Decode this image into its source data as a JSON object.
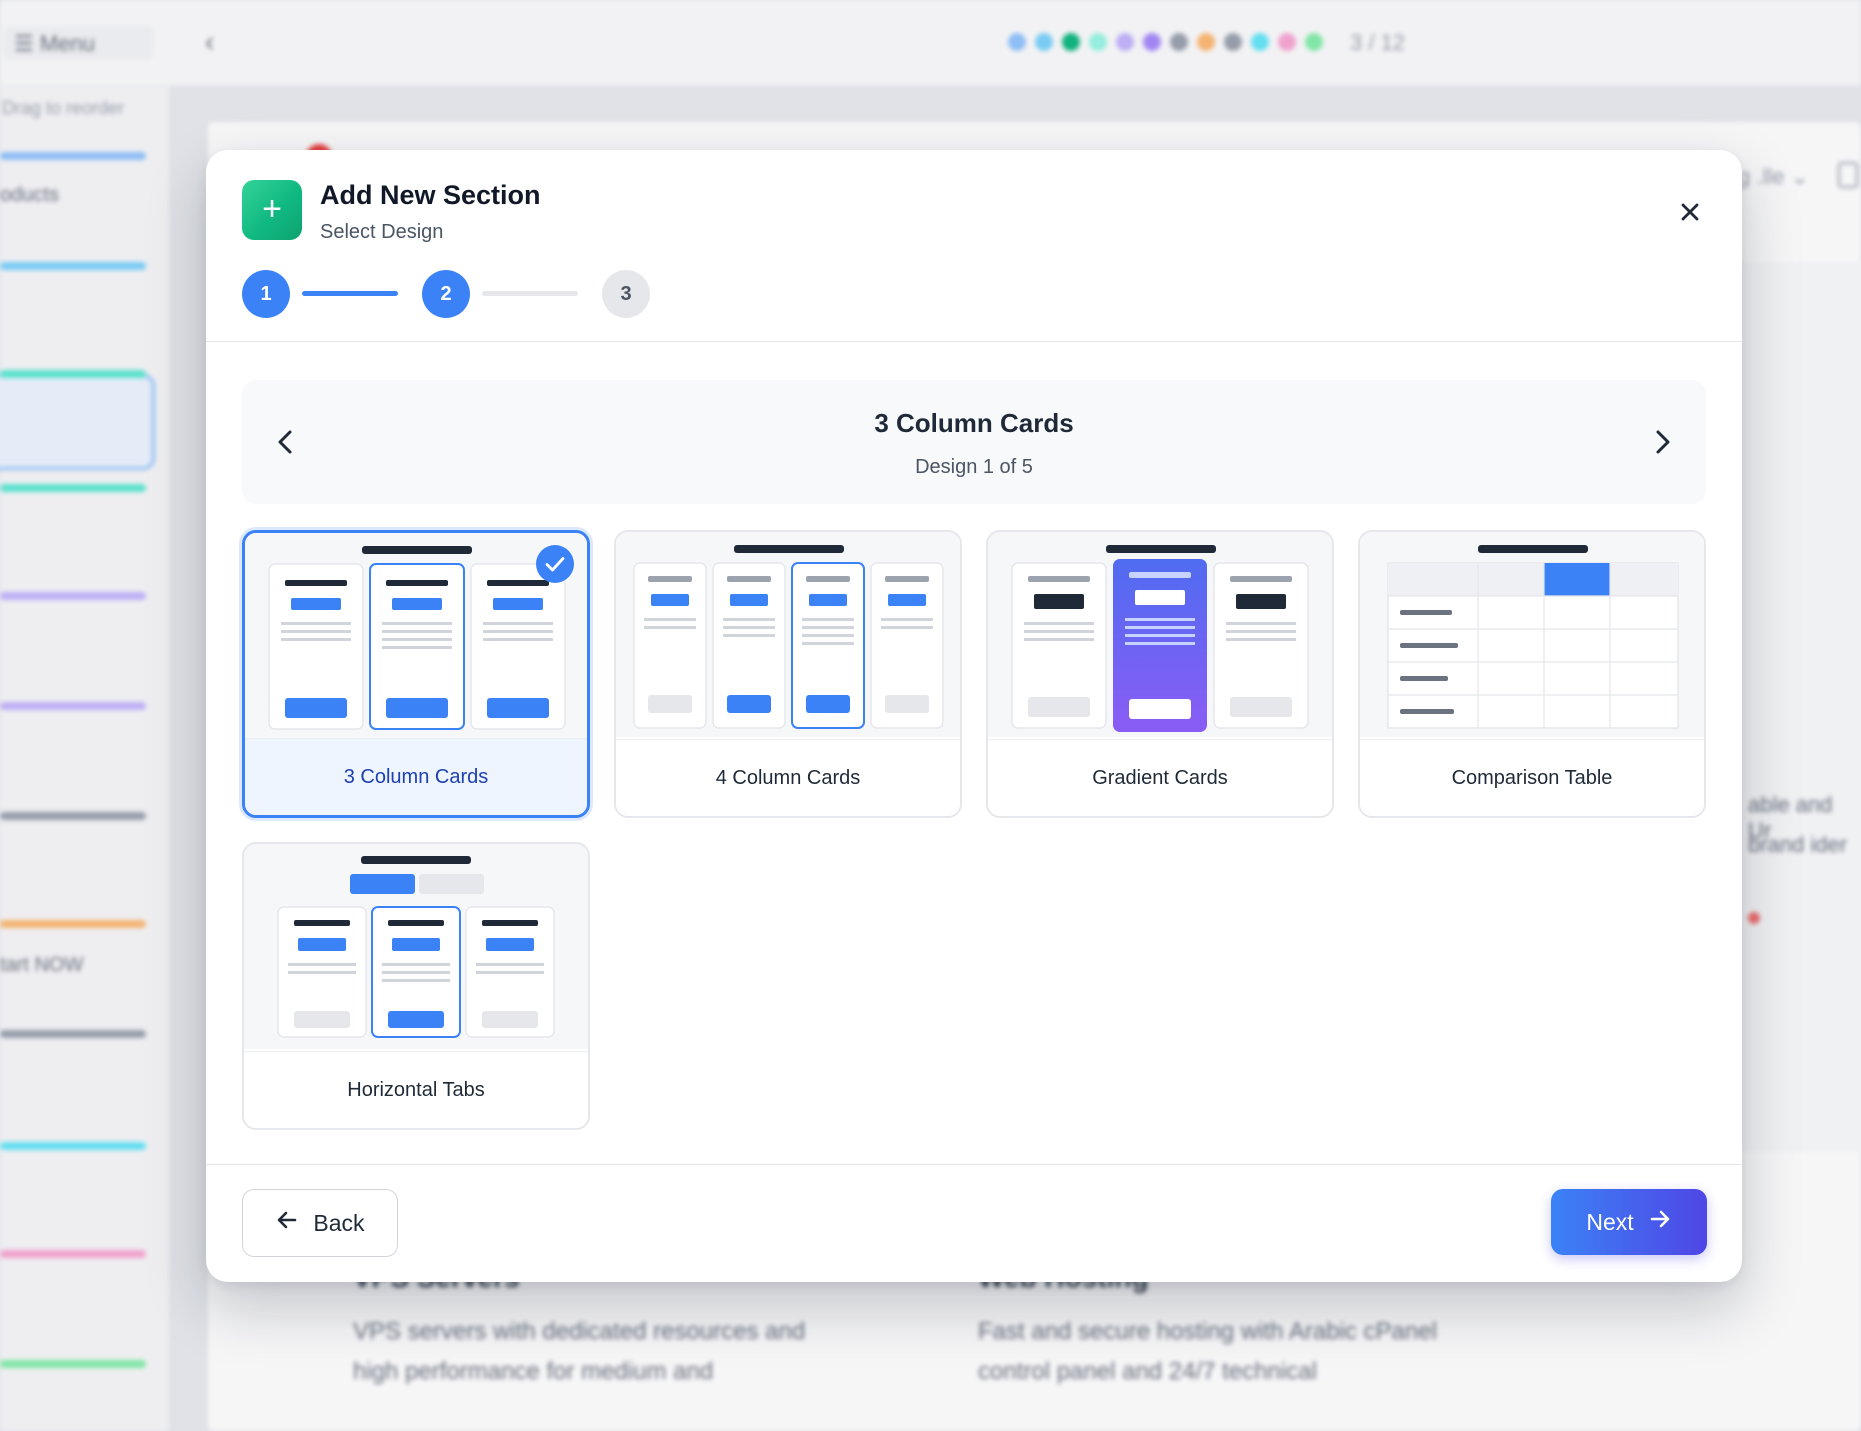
{
  "background": {
    "menu_label": "☰ Menu",
    "page_counter": "3 / 12",
    "sidebar_hint": "Drag to reorder",
    "sidebar_text_1": "oducts",
    "sidebar_text_2": "tart NOW",
    "right_text": "g .lle ⌄",
    "panel_line_1": "able and Ur",
    "panel_line_2": "brand ider",
    "section_1_title": "VPS Servers",
    "section_1_text": "VPS servers with dedicated resources and high performance for medium and",
    "section_2_title": "Web Hosting",
    "section_2_text": "Fast and secure hosting with Arabic cPanel control panel and 24/7 technical"
  },
  "modal": {
    "title": "Add New Section",
    "subtitle": "Select Design",
    "icon": "plus-icon",
    "close_icon": "close-icon",
    "steps": [
      {
        "number": "1",
        "state": "done"
      },
      {
        "number": "2",
        "state": "active"
      },
      {
        "number": "3",
        "state": "todo"
      }
    ],
    "carousel": {
      "current_title": "3 Column Cards",
      "position_text": "Design 1 of 5"
    },
    "designs": [
      {
        "label": "3 Column Cards",
        "selected": true
      },
      {
        "label": "4 Column Cards",
        "selected": false
      },
      {
        "label": "Gradient Cards",
        "selected": false
      },
      {
        "label": "Comparison Table",
        "selected": false
      },
      {
        "label": "Horizontal Tabs",
        "selected": false
      }
    ],
    "footer": {
      "back_label": "Back",
      "next_label": "Next"
    }
  },
  "colors": {
    "accent": "#3b82f6",
    "accent_gradient_end": "#4f46e5",
    "success_icon": "#10b981"
  }
}
